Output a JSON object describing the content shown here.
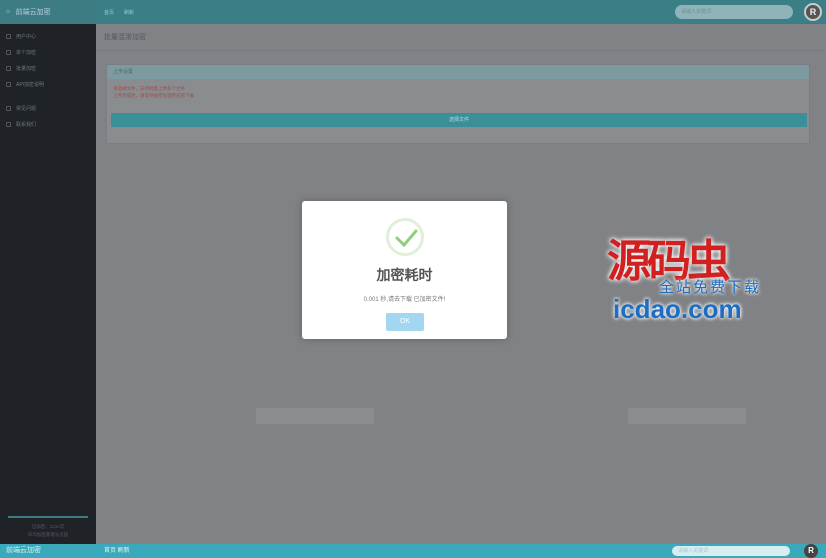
{
  "header": {
    "brand": "前端云加密",
    "nav": [
      "首页",
      "刷新"
    ],
    "search_placeholder": "请输入关键词",
    "avatar_letter": "R"
  },
  "sidebar": {
    "items": [
      {
        "label": "用户中心"
      },
      {
        "label": "单个加密"
      },
      {
        "label": "批量加密"
      },
      {
        "label": "API加密说明"
      },
      {
        "label": "常见问题"
      },
      {
        "label": "联系我们"
      }
    ],
    "stats": [
      "已加密：1234次",
      "日均加密量增长迅猛"
    ]
  },
  "main": {
    "page_title": "批量混淆加密",
    "panel_title": "上传设置",
    "panel_notes": [
      "请选择文件，支持批量上传多个文件",
      "上传完成后，请等待加密处理完成后下载"
    ],
    "upload_button": "选择文件"
  },
  "modal": {
    "title": "加密耗时",
    "message": "0.001 秒,请去下载 已加密文件!",
    "ok_label": "OK"
  },
  "footer": {
    "brand": "前端云加密",
    "nav": "首页  刷新",
    "search_placeholder": "请输入关键词",
    "avatar_letter": "R"
  },
  "watermark": {
    "logo_text": "源码虫",
    "slogan": "全站免费下载",
    "domain": "icdao.com"
  },
  "colors": {
    "accent": "#3aa9bb",
    "ok_button": "#a3d6f1",
    "check": "#8cd17a",
    "watermark_red": "#d21f1f",
    "watermark_blue": "#1d6dc4"
  }
}
